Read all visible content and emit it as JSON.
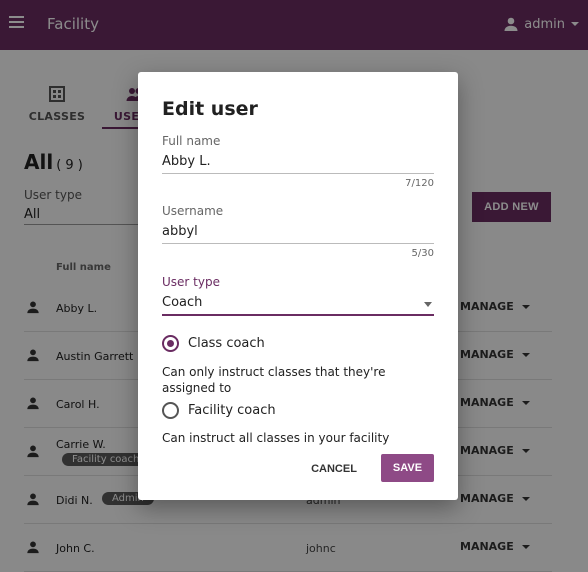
{
  "appbar": {
    "title": "Facility",
    "user_label": "admin"
  },
  "tabs": [
    {
      "label": "CLASSES",
      "icon": "classes-icon"
    },
    {
      "label": "USERS",
      "icon": "users-icon"
    }
  ],
  "list": {
    "heading": "All",
    "count": "( 9 )",
    "filter_label": "User type",
    "filter_value": "All",
    "add_new_label": "ADD NEW",
    "col_full_name": "Full name",
    "rows": [
      {
        "name": "Abby L.",
        "username": "",
        "badge": "",
        "manage": "MANAGE"
      },
      {
        "name": "Austin Garrett",
        "username": "",
        "badge": "",
        "manage": "MANAGE"
      },
      {
        "name": "Carol H.",
        "username": "",
        "badge": "",
        "manage": "MANAGE"
      },
      {
        "name": "Carrie W.",
        "username": "",
        "badge": "Facility coach",
        "manage": "MANAGE"
      },
      {
        "name": "Didi N.",
        "username": "admin",
        "badge": "Admin",
        "manage": "MANAGE"
      },
      {
        "name": "John C.",
        "username": "johnc",
        "badge": "",
        "manage": "MANAGE"
      }
    ]
  },
  "dialog": {
    "title": "Edit user",
    "full_name": {
      "label": "Full name",
      "value": "Abby L.",
      "counter": "7/120"
    },
    "username": {
      "label": "Username",
      "value": "abbyl",
      "counter": "5/30"
    },
    "user_type": {
      "label": "User type",
      "value": "Coach"
    },
    "class_coach": {
      "label": "Class coach",
      "description": "Can only instruct classes that they're assigned to"
    },
    "facility_coach": {
      "label": "Facility coach",
      "description": "Can instruct all classes in your facility"
    },
    "cancel_label": "CANCEL",
    "save_label": "SAVE"
  },
  "colors": {
    "brand": "#6a2c62",
    "save": "#8e4a86"
  }
}
